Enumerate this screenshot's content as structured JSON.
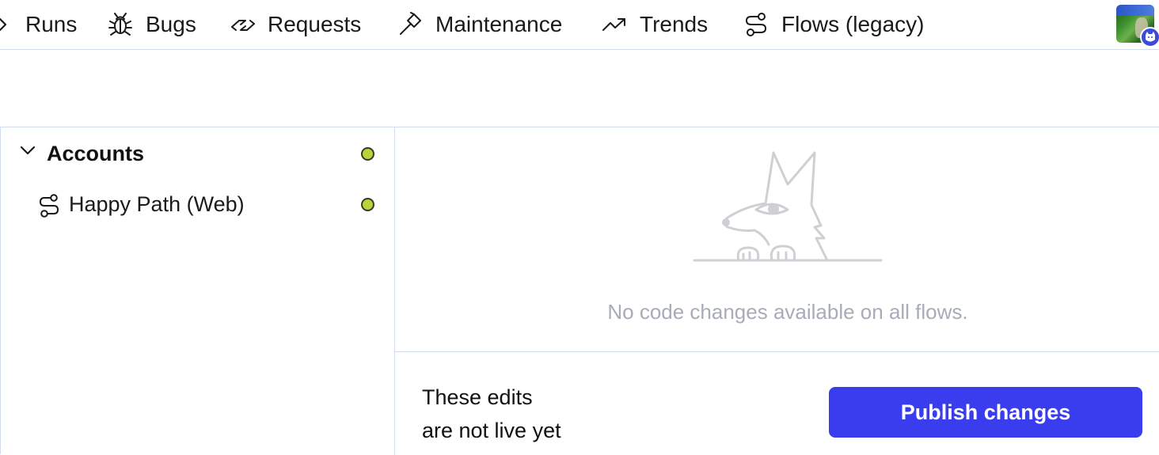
{
  "nav": {
    "items": [
      {
        "label": "Runs",
        "icon": "chevron-right-icon"
      },
      {
        "label": "Bugs",
        "icon": "bug-icon"
      },
      {
        "label": "Requests",
        "icon": "handshake-icon"
      },
      {
        "label": "Maintenance",
        "icon": "hammer-icon"
      },
      {
        "label": "Trends",
        "icon": "trending-up-icon"
      },
      {
        "label": "Flows (legacy)",
        "icon": "flow-icon"
      }
    ],
    "avatar": {
      "icon": "user-avatar",
      "badge_icon": "cat-badge-icon"
    }
  },
  "sidebar": {
    "group": {
      "label": "Accounts",
      "expanded": true,
      "status_color": "#b8d43c"
    },
    "flows": [
      {
        "label": "Happy Path (Web)",
        "status_color": "#b8d43c"
      }
    ]
  },
  "main": {
    "empty_message": "No code changes available on all flows.",
    "illustration": "peeking-fox-illustration"
  },
  "footer": {
    "note_line1": "These edits",
    "note_line2": "are not live yet",
    "publish_label": "Publish changes"
  },
  "colors": {
    "accent": "#3a3ded",
    "status_dot": "#b8d43c",
    "border": "#d4dcf0",
    "muted_text": "#a8acb8"
  }
}
